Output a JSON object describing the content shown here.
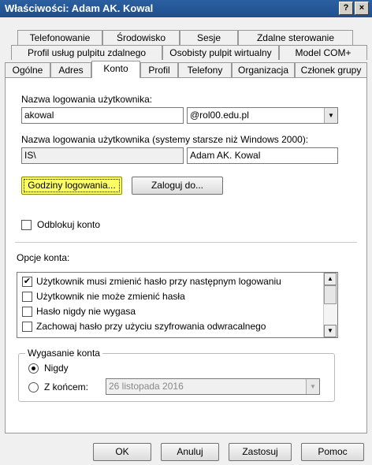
{
  "window": {
    "title": "Właściwości: Adam AK. Kowal",
    "help_button": "?",
    "close_button": "×"
  },
  "tabs": {
    "row1": [
      "Telefonowanie",
      "Środowisko",
      "Sesje",
      "Zdalne sterowanie"
    ],
    "row2": [
      "Profil usług pulpitu zdalnego",
      "Osobisty pulpit wirtualny",
      "Model COM+"
    ],
    "row3": [
      "Ogólne",
      "Adres",
      "Konto",
      "Profil",
      "Telefony",
      "Organizacja",
      "Członek grupy"
    ],
    "active": "Konto"
  },
  "account": {
    "logon_name_label": "Nazwa logowania użytkownika:",
    "logon_name_value": "akowal",
    "domain_value": "@rol00.edu.pl",
    "legacy_label": "Nazwa logowania użytkownika (systemy starsze niż Windows 2000):",
    "legacy_domain_value": "IS\\",
    "legacy_name_value": "Adam AK. Kowal",
    "logon_hours_button": "Godziny logowania...",
    "logon_to_button": "Zaloguj do...",
    "unlock_label": "Odblokuj konto"
  },
  "options": {
    "label": "Opcje konta:",
    "items": [
      {
        "label": "Użytkownik musi zmienić hasło przy następnym logowaniu",
        "checked": true
      },
      {
        "label": "Użytkownik nie może zmienić hasła",
        "checked": false
      },
      {
        "label": "Hasło nigdy nie wygasa",
        "checked": false
      },
      {
        "label": "Zachowaj hasło przy użyciu szyfrowania odwracalnego",
        "checked": false
      }
    ]
  },
  "expiry": {
    "label": "Wygasanie konta",
    "never_label": "Nigdy",
    "end_label": "Z końcem:",
    "end_date": "26  listopada  2016",
    "selected": "never"
  },
  "footer": {
    "ok": "OK",
    "cancel": "Anuluj",
    "apply": "Zastosuj",
    "help": "Pomoc"
  },
  "colors": {
    "title_bar": "#1f4f8e",
    "focus_highlight": "#ffff66"
  }
}
